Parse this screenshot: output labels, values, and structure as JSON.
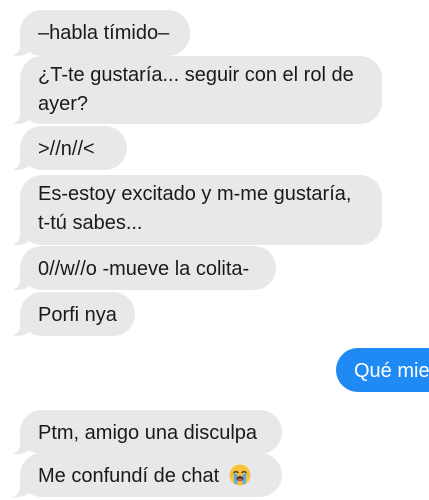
{
  "conversation": {
    "messages": [
      {
        "direction": "incoming",
        "text": "–habla tímido–"
      },
      {
        "direction": "incoming",
        "text": "¿T-te gustaría... seguir con el rol de ayer?"
      },
      {
        "direction": "incoming",
        "text": ">//n//<"
      },
      {
        "direction": "incoming",
        "text": "Es-estoy excitado y m-me gustaría, t-tú sabes..."
      },
      {
        "direction": "incoming",
        "text": "0//w//o -mueve la colita-"
      },
      {
        "direction": "incoming",
        "text": "Porfi nya"
      },
      {
        "direction": "outgoing",
        "text": "Qué mie"
      },
      {
        "direction": "incoming",
        "text": "Ptm, amigo una disculpa"
      },
      {
        "direction": "incoming",
        "text": "Me confundí de chat",
        "emoji": "loudly-crying-face"
      }
    ]
  },
  "colors": {
    "incoming_bubble": "#e8e8ea",
    "outgoing_bubble": "#1f8af4",
    "background": "#ffffff",
    "emoji_face": "#f7c23c"
  }
}
